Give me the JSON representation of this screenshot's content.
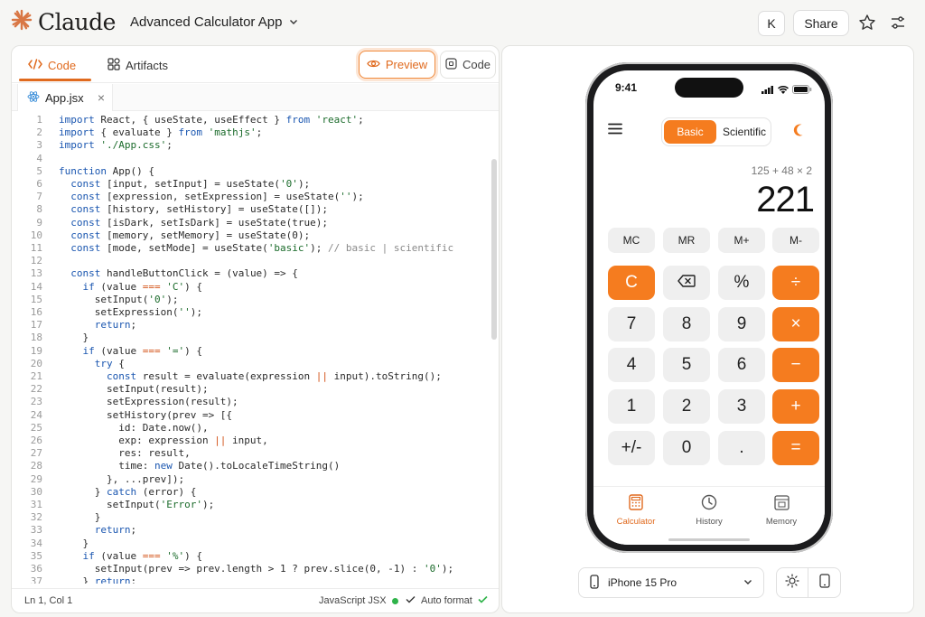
{
  "app": {
    "logo_text": "Claude",
    "project_title": "Advanced Calculator App",
    "avatar_initial": "K",
    "share_label": "Share"
  },
  "left_panel": {
    "tab_code": "Code",
    "tab_artifacts": "Artifacts",
    "preview_label": "Preview",
    "code_label": "Code",
    "file_name": "App.jsx",
    "status": {
      "cursor": "Ln 1, Col 1",
      "language": "JavaScript JSX",
      "format": "Auto format"
    },
    "code_lines": [
      "import React, { useState, useEffect } from 'react';",
      "import { evaluate } from 'mathjs';",
      "import './App.css';",
      "",
      "function App() {",
      "  const [input, setInput] = useState('0');",
      "  const [expression, setExpression] = useState('');",
      "  const [history, setHistory] = useState([]);",
      "  const [isDark, setIsDark] = useState(true);",
      "  const [memory, setMemory] = useState(0);",
      "  const [mode, setMode] = useState('basic'); // basic | scientific",
      "",
      "  const handleButtonClick = (value) => {",
      "    if (value === 'C') {",
      "      setInput('0');",
      "      setExpression('');",
      "      return;",
      "    }",
      "    if (value === '=') {",
      "      try {",
      "        const result = evaluate(expression || input).toString();",
      "        setInput(result);",
      "        setExpression(result);",
      "        setHistory(prev => [{",
      "          id: Date.now(),",
      "          exp: expression || input,",
      "          res: result,",
      "          time: new Date().toLocaleTimeString()",
      "        }, ...prev]);",
      "      } catch (error) {",
      "        setInput('Error');",
      "      }",
      "      return;",
      "    }",
      "    if (value === '%') {",
      "      setInput(prev => prev.length > 1 ? prev.slice(0, -1) : '0');",
      "    } return;"
    ]
  },
  "phone": {
    "time": "9:41",
    "mode_basic": "Basic",
    "mode_scientific": "Scientific",
    "expression": "125 + 48 × 2",
    "result": "221",
    "memory_keys": [
      "MC",
      "MR",
      "M+",
      "M-"
    ],
    "keys": [
      [
        "C",
        "⌫",
        "%",
        "÷"
      ],
      [
        "7",
        "8",
        "9",
        "×"
      ],
      [
        "4",
        "5",
        "6",
        "−"
      ],
      [
        "1",
        "2",
        "3",
        "+"
      ],
      [
        "+/-",
        "0",
        ".",
        "="
      ]
    ],
    "nav": [
      "Calculator",
      "History",
      "Memory"
    ]
  },
  "device": {
    "selected": "iPhone 15 Pro"
  },
  "colors": {
    "accent": "#f57c1f",
    "accent_text": "#e06a1e",
    "key_bg": "#efefef"
  }
}
